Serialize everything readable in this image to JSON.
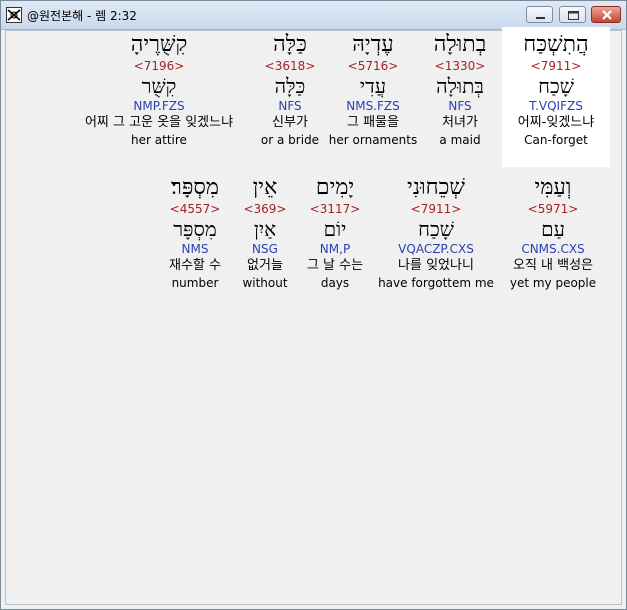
{
  "window": {
    "title": "@원전본해 - 렘 2:32",
    "buttons": {
      "minimize": "minimize",
      "maximize": "maximize",
      "close": "close"
    }
  },
  "icons": {
    "app": "app-logo-icon",
    "minimize": "minimize-icon",
    "maximize": "maximize-icon",
    "close": "close-icon"
  },
  "colors": {
    "strong": "#a52222",
    "morph": "#2b3fb5",
    "selected_background": "#ffffff"
  },
  "rows": [
    {
      "words": [
        {
          "hebrew": "הֲתִשְׁכַּח",
          "strong": "<7911>",
          "root": "שָׁכַח",
          "morph": "T.VQIFZS",
          "korean": "어찌-잊겠느냐",
          "english": "Can-forget",
          "selected": true
        },
        {
          "hebrew": "בְתוּלָה",
          "strong": "<1330>",
          "root": "בְּתוּלָה",
          "morph": "NFS",
          "korean": "처녀가",
          "english": "a maid"
        },
        {
          "hebrew": "עֶדְיָהּ",
          "strong": "<5716>",
          "root": "עֲדִי",
          "morph": "NMS.FZS",
          "korean": "그 패물을",
          "english": "her ornaments"
        },
        {
          "hebrew": "כַּלָּה",
          "strong": "<3618>",
          "root": "כַּלָּה",
          "morph": "NFS",
          "korean": "신부가",
          "english": "or a bride"
        },
        {
          "hebrew": "קִשֻּׁרֶיהָ",
          "strong": "<7196>",
          "root": "קִשֻּׁר",
          "morph": "NMP.FZS",
          "korean": "어찌 그 고운 옷을 잊겠느냐",
          "english": "her attire"
        }
      ]
    },
    {
      "words": [
        {
          "hebrew": "וְעַמִּי",
          "strong": "<5971>",
          "root": "עַם",
          "morph": "CNMS.CXS",
          "korean": "오직 내 백성은",
          "english": "yet my people"
        },
        {
          "hebrew": "שְׁכֵחוּנִי",
          "strong": "<7911>",
          "root": "שָׁכַח",
          "morph": "VQACZP.CXS",
          "korean": "나를 잊었나니",
          "english": "have forgottem me"
        },
        {
          "hebrew": "יָמִים",
          "strong": "<3117>",
          "root": "יוֹם",
          "morph": "NM,P",
          "korean": "그 날 수는",
          "english": "days"
        },
        {
          "hebrew": "אֵין",
          "strong": "<369>",
          "root": "אַיִן",
          "morph": "NSG",
          "korean": "없거늘",
          "english": "without"
        },
        {
          "hebrew": "מִסְפָּר׃",
          "strong": "<4557>",
          "root": "מִסְפָּר",
          "morph": "NMS",
          "korean": "재수할 수",
          "english": "number"
        }
      ]
    }
  ]
}
